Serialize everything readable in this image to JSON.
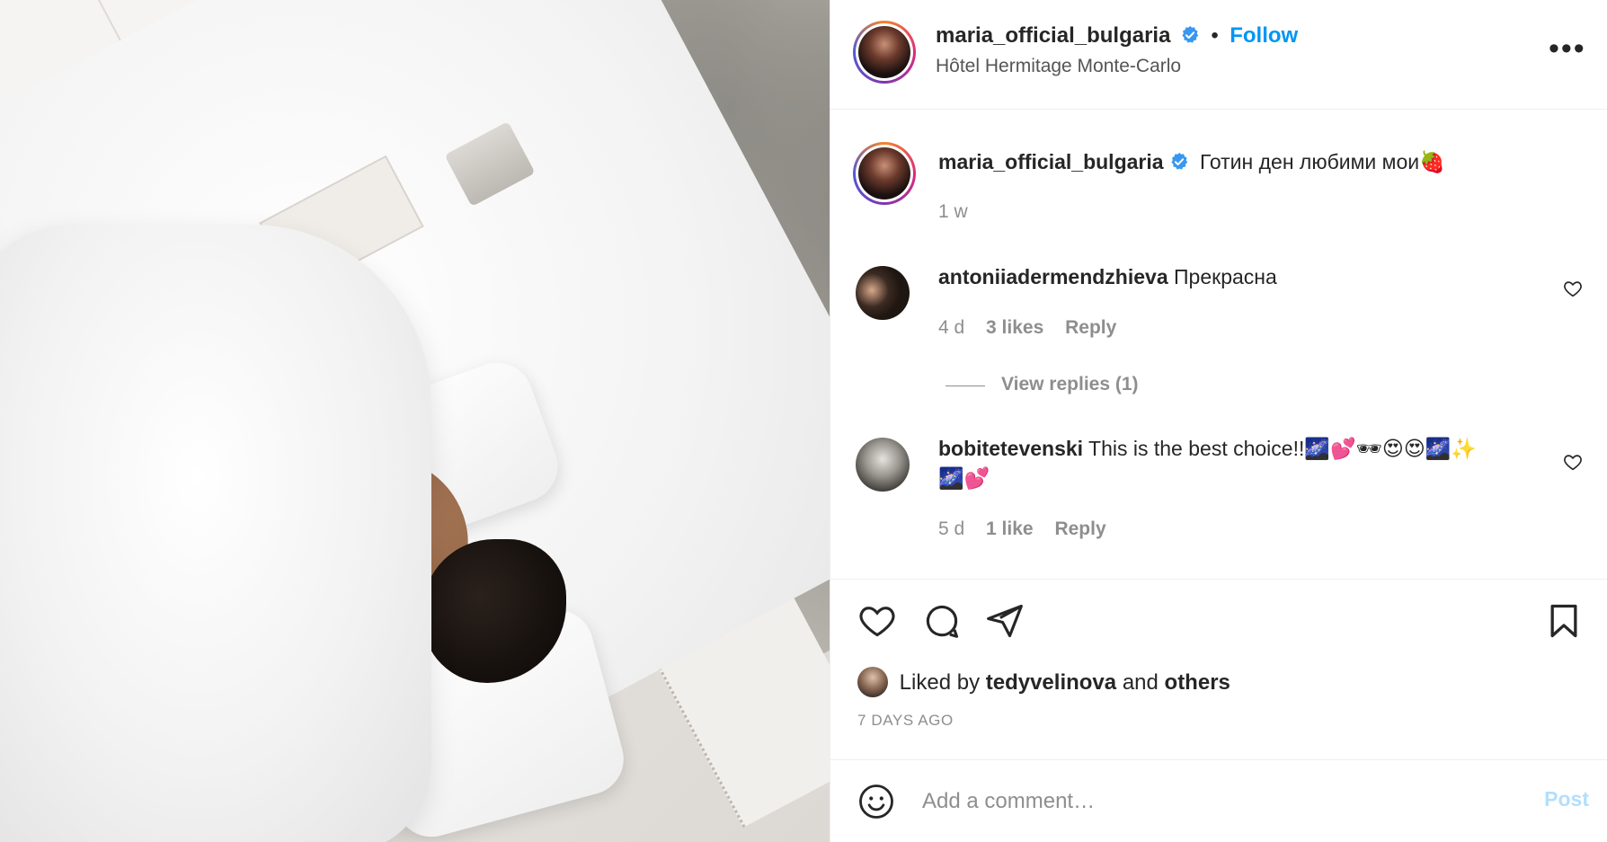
{
  "post": {
    "image_alt": "photo"
  },
  "header": {
    "username": "maria_official_bulgaria",
    "follow_label": "Follow",
    "separator": "•",
    "location": "Hôtel Hermitage Monte-Carlo",
    "more_icon": "more-icon"
  },
  "caption": {
    "username": "maria_official_bulgaria",
    "text": "Готин ден любими мои🍓",
    "time": "1 w"
  },
  "comments": [
    {
      "username": "antoniiadermendzhieva",
      "text": "Прекрасна",
      "time": "4 d",
      "likes": "3 likes",
      "reply_label": "Reply",
      "view_replies": "View replies (1)"
    },
    {
      "username": "bobitetevenski",
      "text": "This is the best choice!!🌌💕🕶😍😍🌌✨",
      "text_line2": "🌌💕",
      "time": "5 d",
      "likes": "1 like",
      "reply_label": "Reply"
    }
  ],
  "likes": {
    "prefix": "Liked by",
    "user": "tedyvelinova",
    "and": "and",
    "others": "others"
  },
  "date_label": "7 DAYS AGO",
  "add_comment": {
    "placeholder": "Add a comment…",
    "post_label": "Post"
  },
  "colors": {
    "accent": "#0095f6",
    "post_disabled": "#b2dffc",
    "muted": "#8e8e8e",
    "text": "#262626"
  }
}
